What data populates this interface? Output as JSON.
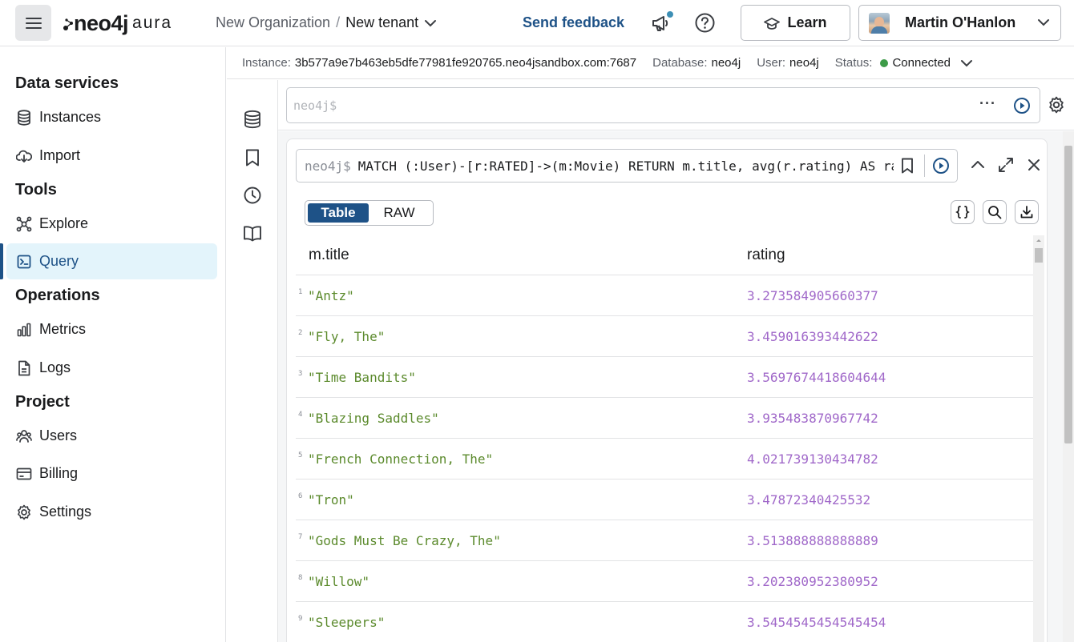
{
  "header": {
    "logo_neo": "neo4j",
    "logo_aura": "aura",
    "org": "New Organization",
    "separator": "/",
    "tenant": "New tenant",
    "feedback": "Send feedback",
    "learn": "Learn",
    "user": "Martin O'Hanlon"
  },
  "sidebar": {
    "sections": [
      {
        "title": "Data services",
        "items": [
          {
            "label": "Instances",
            "icon": "database-icon"
          },
          {
            "label": "Import",
            "icon": "import-icon"
          }
        ]
      },
      {
        "title": "Tools",
        "items": [
          {
            "label": "Explore",
            "icon": "explore-icon"
          },
          {
            "label": "Query",
            "icon": "query-icon",
            "active": true
          }
        ]
      },
      {
        "title": "Operations",
        "items": [
          {
            "label": "Metrics",
            "icon": "metrics-icon"
          },
          {
            "label": "Logs",
            "icon": "logs-icon"
          }
        ]
      },
      {
        "title": "Project",
        "items": [
          {
            "label": "Users",
            "icon": "users-icon"
          },
          {
            "label": "Billing",
            "icon": "billing-icon"
          },
          {
            "label": "Settings",
            "icon": "settings-icon"
          }
        ]
      }
    ]
  },
  "infobar": {
    "instance_label": "Instance:",
    "instance_value": "3b577a9e7b463eb5dfe77981fe920765.neo4jsandbox.com:7687",
    "database_label": "Database:",
    "database_value": "neo4j",
    "user_label": "User:",
    "user_value": "neo4j",
    "status_label": "Status:",
    "status_value": "Connected"
  },
  "editor": {
    "prompt": "neo4j$"
  },
  "frame": {
    "prompt": "neo4j$",
    "query": "MATCH (:User)-[r:RATED]->(m:Movie) RETURN m.title, avg(r.rating) AS rating",
    "view_table": "Table",
    "view_raw": "RAW",
    "columns": [
      "m.title",
      "rating"
    ],
    "rows": [
      {
        "idx": "1",
        "title": "\"Antz\"",
        "rating": "3.273584905660377"
      },
      {
        "idx": "2",
        "title": "\"Fly, The\"",
        "rating": "3.459016393442622"
      },
      {
        "idx": "3",
        "title": "\"Time Bandits\"",
        "rating": "3.5697674418604644"
      },
      {
        "idx": "4",
        "title": "\"Blazing Saddles\"",
        "rating": "3.935483870967742"
      },
      {
        "idx": "5",
        "title": "\"French Connection, The\"",
        "rating": "4.021739130434782"
      },
      {
        "idx": "6",
        "title": "\"Tron\"",
        "rating": "3.47872340425532"
      },
      {
        "idx": "7",
        "title": "\"Gods Must Be Crazy, The\"",
        "rating": "3.513888888888889"
      },
      {
        "idx": "8",
        "title": "\"Willow\"",
        "rating": "3.202380952380952"
      },
      {
        "idx": "9",
        "title": "\"Sleepers\"",
        "rating": "3.5454545454545454"
      }
    ]
  },
  "colors": {
    "brand_blue": "#1e5287",
    "active_bg": "#e3f4fb",
    "string_green": "#5b8a2c",
    "number_purple": "#a068c9",
    "status_green": "#3d9b48"
  }
}
